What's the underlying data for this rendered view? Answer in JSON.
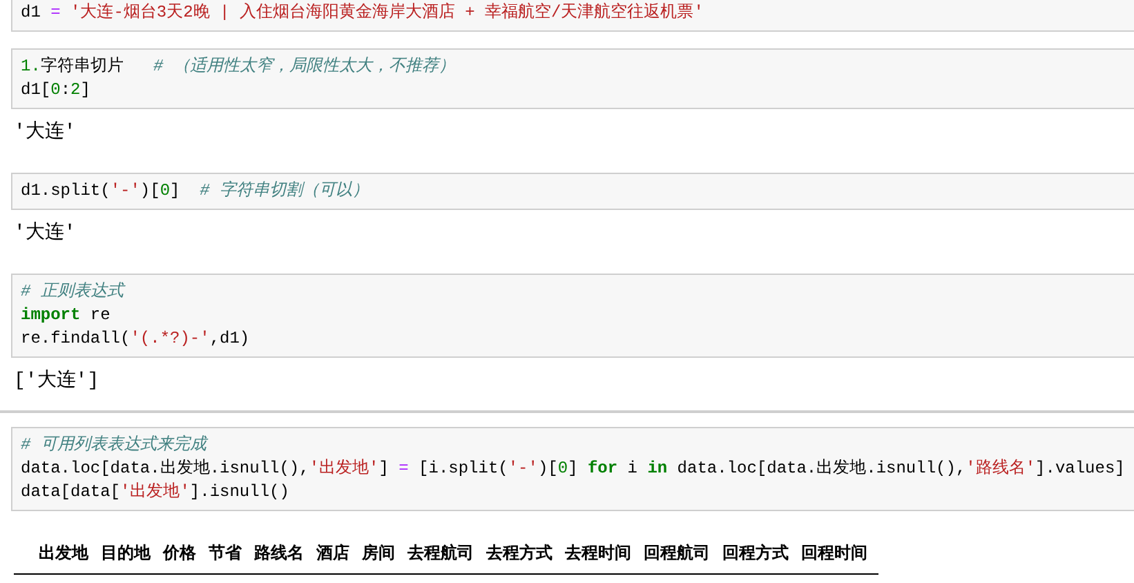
{
  "cells": [
    {
      "code": [
        [
          {
            "kind": "name",
            "text": "d1 "
          },
          {
            "kind": "op",
            "text": "="
          },
          {
            "kind": "string",
            "text": " '大连-烟台3天2晚 | 入住烟台海阳黄金海岸大酒店 + 幸福航空/天津航空往返机票'"
          }
        ]
      ]
    },
    {
      "code": [
        [
          {
            "kind": "number",
            "text": "1."
          },
          {
            "kind": "name",
            "text": "字符串切片   "
          },
          {
            "kind": "comment",
            "text": "# （适用性太窄，局限性太大，不推荐）"
          }
        ],
        [
          {
            "kind": "name",
            "text": "d1["
          },
          {
            "kind": "number",
            "text": "0"
          },
          {
            "kind": "name",
            "text": ":"
          },
          {
            "kind": "number",
            "text": "2"
          },
          {
            "kind": "name",
            "text": "]"
          }
        ]
      ],
      "output": {
        "kind": "text",
        "text": "'大连'"
      }
    },
    {
      "code": [
        [
          {
            "kind": "name",
            "text": "d1.split("
          },
          {
            "kind": "string",
            "text": "'-'"
          },
          {
            "kind": "name",
            "text": ")["
          },
          {
            "kind": "number",
            "text": "0"
          },
          {
            "kind": "name",
            "text": "]  "
          },
          {
            "kind": "comment",
            "text": "# 字符串切割（可以）"
          }
        ]
      ],
      "output": {
        "kind": "text",
        "text": "'大连'"
      }
    },
    {
      "code": [
        [
          {
            "kind": "comment",
            "text": "# 正则表达式"
          }
        ],
        [
          {
            "kind": "keyword",
            "text": "import"
          },
          {
            "kind": "name",
            "text": " re"
          }
        ],
        [
          {
            "kind": "name",
            "text": "re.findall("
          },
          {
            "kind": "string",
            "text": "'(.*?)-'"
          },
          {
            "kind": "name",
            "text": ",d1)"
          }
        ]
      ],
      "output": {
        "kind": "text",
        "text": "['大连']"
      }
    },
    {
      "code": [
        [
          {
            "kind": "comment",
            "text": "# 可用列表表达式来完成"
          }
        ],
        [
          {
            "kind": "name",
            "text": "data.loc[data.出发地.isnull(),"
          },
          {
            "kind": "string",
            "text": "'出发地'"
          },
          {
            "kind": "name",
            "text": "] "
          },
          {
            "kind": "op",
            "text": "="
          },
          {
            "kind": "name",
            "text": " [i.split("
          },
          {
            "kind": "string",
            "text": "'-'"
          },
          {
            "kind": "name",
            "text": ")["
          },
          {
            "kind": "number",
            "text": "0"
          },
          {
            "kind": "name",
            "text": "] "
          },
          {
            "kind": "keyword",
            "text": "for"
          },
          {
            "kind": "name",
            "text": " i "
          },
          {
            "kind": "keyword",
            "text": "in"
          },
          {
            "kind": "name",
            "text": " data.loc[data.出发地.isnull(),"
          },
          {
            "kind": "string",
            "text": "'路线名'"
          },
          {
            "kind": "name",
            "text": "].values]"
          }
        ],
        [
          {
            "kind": "name",
            "text": "data[data["
          },
          {
            "kind": "string",
            "text": "'出发地'"
          },
          {
            "kind": "name",
            "text": "].isnull()"
          }
        ]
      ],
      "output": {
        "kind": "table",
        "columns": [
          "出发地",
          "目的地",
          "价格",
          "节省",
          "路线名",
          "酒店",
          "房间",
          "去程航司",
          "去程方式",
          "去程时间",
          "回程航司",
          "回程方式",
          "回程时间"
        ]
      }
    }
  ]
}
